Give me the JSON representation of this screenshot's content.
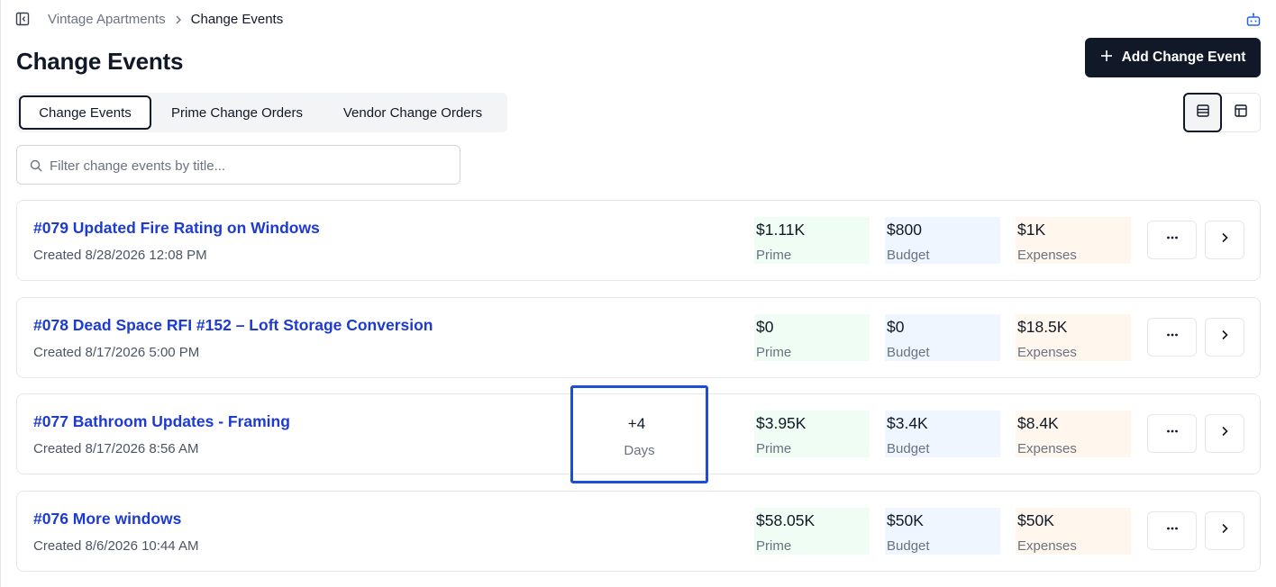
{
  "breadcrumb": {
    "project": "Vintage Apartments",
    "current": "Change Events"
  },
  "page": {
    "title": "Change Events",
    "add_button_label": "Add Change Event"
  },
  "tabs": [
    {
      "label": "Change Events",
      "active": true
    },
    {
      "label": "Prime Change Orders",
      "active": false
    },
    {
      "label": "Vendor Change Orders",
      "active": false
    }
  ],
  "view_toggle": {
    "selected": "list"
  },
  "search": {
    "placeholder": "Filter change events by title...",
    "value": ""
  },
  "metric_labels": {
    "prime": "Prime",
    "budget": "Budget",
    "expenses": "Expenses"
  },
  "events": [
    {
      "title": "#079 Updated Fire Rating on Windows",
      "created": "Created 8/28/2026 12:08 PM",
      "prime": "$1.11K",
      "budget": "$800",
      "expenses": "$1K"
    },
    {
      "title": "#078 Dead Space RFI #152 – Loft Storage Conversion",
      "created": "Created 8/17/2026 5:00 PM",
      "prime": "$0",
      "budget": "$0",
      "expenses": "$18.5K"
    },
    {
      "title": "#077 Bathroom Updates - Framing",
      "created": "Created 8/17/2026 8:56 AM",
      "prime": "$3.95K",
      "budget": "$3.4K",
      "expenses": "$8.4K",
      "schedule_impact": {
        "value": "+4",
        "label": "Days"
      }
    },
    {
      "title": "#076 More windows",
      "created": "Created 8/6/2026 10:44 AM",
      "prime": "$58.05K",
      "budget": "$50K",
      "expenses": "$50K"
    }
  ],
  "colors": {
    "link": "#1d3bd1",
    "prime_bg": "#f0fdf4",
    "budget_bg": "#eff6ff",
    "expenses_bg": "#fff7ed",
    "highlight_border": "#1d4ed8",
    "primary_button": "#111827"
  }
}
